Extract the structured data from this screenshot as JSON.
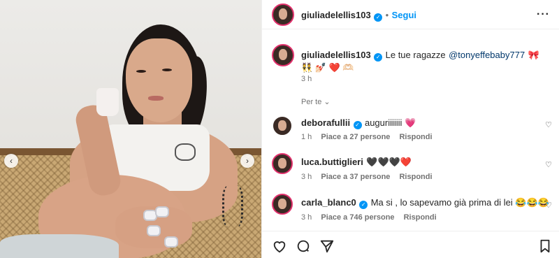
{
  "post": {
    "author": "giulia delellis103",
    "follow_label": "Segui",
    "more_icon": "more-dots-icon"
  },
  "caption": {
    "username": "giuliadelellis103",
    "text": "Le tue ragazze",
    "mention": "@tonyeffebaby777",
    "emojis": "🎀 👯 💅🏻 ❤️ 🫶🏻",
    "time": "3 h"
  },
  "filter_label": "Per te",
  "comments": [
    {
      "username": "deborafullii",
      "text": "auguriiiiiii 💗",
      "time": "1 h",
      "likes": "Piace a 27 persone",
      "reply": "Rispondi"
    },
    {
      "username": "luca.buttiglieri",
      "text": "🖤🖤🖤❤️",
      "time": "3 h",
      "likes": "Piace a 37 persone",
      "reply": "Rispondi"
    },
    {
      "username": "carla_blanc0",
      "text": "Ma si , lo sapevamo già prima di lei 😂😂😂",
      "time": "3 h",
      "likes": "Piace a 746 persone",
      "reply": "Rispondi"
    }
  ],
  "colors": {
    "accent": "#0095f6",
    "text": "#262626",
    "muted": "#737373"
  }
}
